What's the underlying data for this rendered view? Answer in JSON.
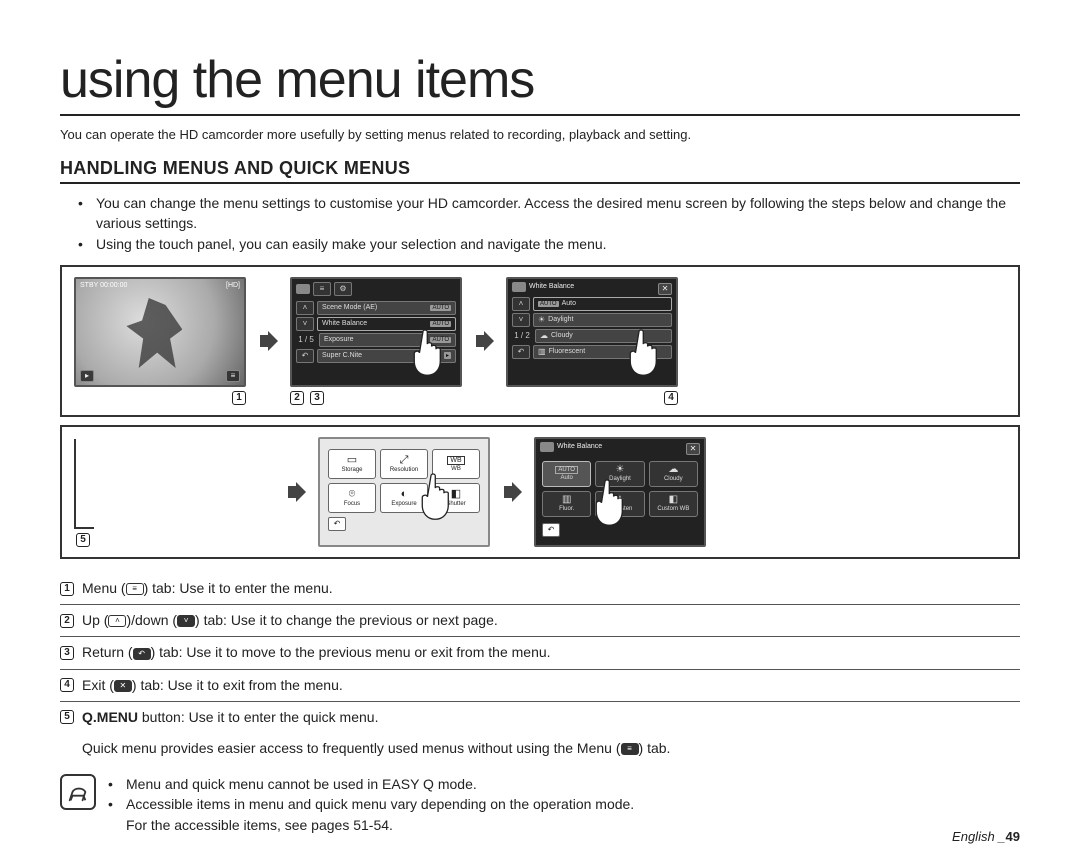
{
  "title": "using the menu items",
  "intro": "You can operate the HD camcorder more usefully by setting menus related to recording, playback and setting.",
  "section_heading": "HANDLING MENUS AND QUICK MENUS",
  "bullets": [
    "You can change the menu settings to customise your HD camcorder. Access the desired menu screen by following the steps below and change the various settings.",
    "Using the touch panel, you can easily make your selection and navigate the menu."
  ],
  "screen1": {
    "top_left": "STBY 00:00:00",
    "top_right": "[HD]"
  },
  "screen2": {
    "items": [
      "Scene Mode (AE)",
      "White Balance",
      "Exposure",
      "Super C.Nite"
    ],
    "pager": "1 / 5",
    "tag": "AUTO"
  },
  "screen3": {
    "header": "White Balance",
    "items": [
      "Auto",
      "Daylight",
      "Cloudy",
      "Fluorescent"
    ],
    "pager": "1 / 2",
    "tag": "AUTO"
  },
  "screen4": {
    "items": [
      "Storage",
      "Resolution",
      "WB",
      "Focus",
      "Exposure",
      "Shutter"
    ]
  },
  "screen5": {
    "header": "White Balance",
    "items": [
      "Auto",
      "Daylight",
      "Cloudy",
      "Fluor.",
      "Tungsten",
      "Custom WB"
    ]
  },
  "legend": {
    "1": {
      "pre": "Menu (",
      "post": ") tab: Use it to enter the menu."
    },
    "2": {
      "pre": "Up (",
      "mid": ")/down (",
      "post": ") tab: Use it to change the previous or next page."
    },
    "3": {
      "pre": "Return (",
      "post": ") tab: Use it to move to the previous menu or exit from the menu."
    },
    "4": {
      "pre": "Exit (",
      "post": ") tab: Use it to exit from the menu."
    },
    "5": {
      "bold": "Q.MENU",
      "post": " button: Use it to enter the quick menu."
    },
    "extra": {
      "pre": "Quick menu provides easier access to frequently used menus without using the Menu (",
      "post": ") tab."
    }
  },
  "notes": [
    "Menu and quick menu cannot be used in EASY Q mode.",
    "Accessible items in menu and quick menu vary depending on the operation mode.",
    "For the accessible items, see pages 51-54."
  ],
  "footer": {
    "lang": "English",
    "sep": " _",
    "page": "49"
  }
}
